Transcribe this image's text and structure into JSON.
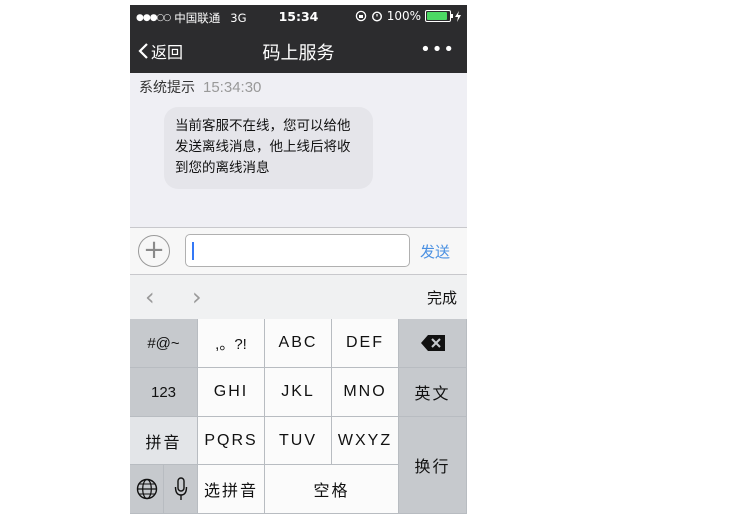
{
  "status_bar": {
    "signal": "●●●○○",
    "carrier": "中国联通",
    "network": "3G",
    "time": "15:34",
    "battery": "100%"
  },
  "nav": {
    "back_label": "返回",
    "title": "码上服务",
    "more": "•••"
  },
  "chat": {
    "system_label": "系统提示",
    "system_time": "15:34:30",
    "message": "当前客服不在线，您可以给他发送离线消息，他上线后将收到您的离线消息"
  },
  "input_bar": {
    "value": "",
    "send_label": "发送"
  },
  "accessory": {
    "prev": "‹",
    "next": "›",
    "done_label": "完成"
  },
  "keyboard": {
    "symbols": "#@~",
    "punctuation": ",。?!",
    "abc": "ABC",
    "def": "DEF",
    "num": "123",
    "ghi": "GHI",
    "jkl": "JKL",
    "mno": "MNO",
    "english": "英文",
    "pinyin": "拼音",
    "pqrs": "PQRS",
    "tuv": "TUV",
    "wxyz": "WXYZ",
    "switch": "换行",
    "select_pinyin": "选拼音",
    "space": "空格"
  },
  "colors": {
    "nav_background": "#2c2c2e",
    "accent": "#4a90e2",
    "battery_green": "#4cd964"
  }
}
